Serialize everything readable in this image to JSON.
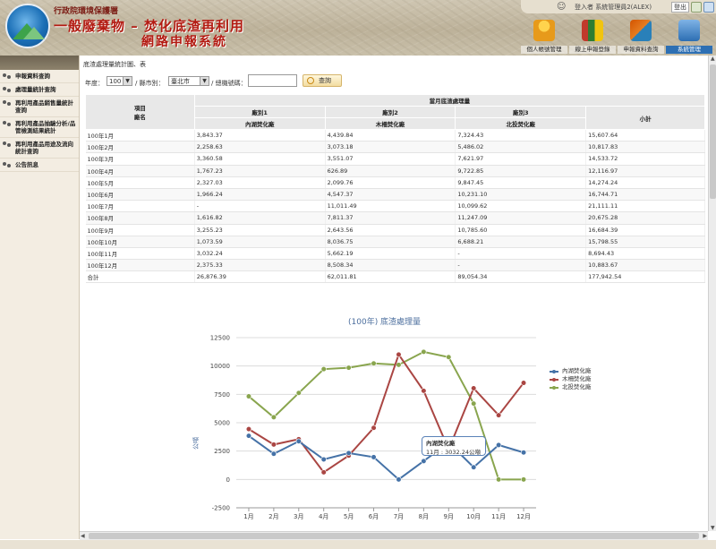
{
  "header": {
    "org": "行政院環境保護署",
    "system_line1": "一般廢棄物 – 焚化底渣再利用",
    "system_line2": "網路申報系統",
    "login_info": "登入者 系統管理員2(ALEX)",
    "logout": "登出",
    "nav": [
      {
        "label": "個人帳號管理",
        "icon": "person-icon"
      },
      {
        "label": "線上申報登錄",
        "icon": "books-icon"
      },
      {
        "label": "申報資料查詢",
        "icon": "tools-icon"
      },
      {
        "label": "系統管理",
        "icon": "computer-icon",
        "active": true
      }
    ]
  },
  "sidebar": {
    "items": [
      {
        "label": "申報資料查詢"
      },
      {
        "label": "處理量統計查詢"
      },
      {
        "label": "再利用產品銷售量統計查詢"
      },
      {
        "label": "再利用產品抽驗分析/品管檢測結果統計"
      },
      {
        "label": "再利用產品用途及流向統計查詢"
      },
      {
        "label": "公告訊息"
      }
    ]
  },
  "main": {
    "breadcrumb": "底渣處理量統計圖、表",
    "filters": {
      "year_label": "年度：",
      "year_value": "100",
      "city_label": "/ 縣市別：",
      "city_value": "臺北市",
      "agency_label": "/ 總機號碼：",
      "query_label": "查詢"
    },
    "table": {
      "header_item": "項目",
      "header_factory": "廠名",
      "header_group": "當月底渣處理量",
      "categories": [
        "廠別1",
        "廠別2",
        "廠別3"
      ],
      "factories": [
        "內湖焚化廠",
        "木柵焚化廠",
        "北投焚化廠"
      ],
      "subtotal": "小計",
      "rows": [
        [
          "100年1月",
          "3,843.37",
          "4,439.84",
          "7,324.43",
          "15,607.64"
        ],
        [
          "100年2月",
          "2,258.63",
          "3,073.18",
          "5,486.02",
          "10,817.83"
        ],
        [
          "100年3月",
          "3,360.58",
          "3,551.07",
          "7,621.97",
          "14,533.72"
        ],
        [
          "100年4月",
          "1,767.23",
          "626.89",
          "9,722.85",
          "12,116.97"
        ],
        [
          "100年5月",
          "2,327.03",
          "2,099.76",
          "9,847.45",
          "14,274.24"
        ],
        [
          "100年6月",
          "1,966.24",
          "4,547.37",
          "10,231.10",
          "16,744.71"
        ],
        [
          "100年7月",
          "-",
          "11,011.49",
          "10,099.62",
          "21,111.11"
        ],
        [
          "100年8月",
          "1,616.82",
          "7,811.37",
          "11,247.09",
          "20,675.28"
        ],
        [
          "100年9月",
          "3,255.23",
          "2,643.56",
          "10,785.60",
          "16,684.39"
        ],
        [
          "100年10月",
          "1,073.59",
          "8,036.75",
          "6,688.21",
          "15,798.55"
        ],
        [
          "100年11月",
          "3,032.24",
          "5,662.19",
          "-",
          "8,694.43"
        ],
        [
          "100年12月",
          "2,375.33",
          "8,508.34",
          "-",
          "10,883.67"
        ],
        [
          "合計",
          "26,876.39",
          "62,011.81",
          "89,054.34",
          "177,942.54"
        ]
      ]
    },
    "tooltip": {
      "title": "內湖焚化廠",
      "text": "11月 : 3032.24公噸"
    }
  },
  "colors": {
    "series1": "#4572a7",
    "series2": "#aa4643",
    "series3": "#89a54e"
  },
  "chart_data": {
    "type": "line",
    "title": "(100年) 底渣處理量",
    "ylabel": "公噸",
    "ylim": [
      -2500,
      12500
    ],
    "yticks": [
      -2500,
      0,
      2500,
      5000,
      7500,
      10000,
      12500
    ],
    "categories": [
      "1月",
      "2月",
      "3月",
      "4月",
      "5月",
      "6月",
      "7月",
      "8月",
      "9月",
      "10月",
      "11月",
      "12月"
    ],
    "series": [
      {
        "name": "內湖焚化廠",
        "values": [
          3843.37,
          2258.63,
          3360.58,
          1767.23,
          2327.03,
          1966.24,
          0,
          1616.82,
          3255.23,
          1073.59,
          3032.24,
          2375.33
        ]
      },
      {
        "name": "木柵焚化廠",
        "values": [
          4439.84,
          3073.18,
          3551.07,
          626.89,
          2099.76,
          4547.37,
          11011.49,
          7811.37,
          2643.56,
          8036.75,
          5662.19,
          8508.34
        ]
      },
      {
        "name": "北投焚化廠",
        "values": [
          7324.43,
          5486.02,
          7621.97,
          9722.85,
          9847.45,
          10231.1,
          10099.62,
          11247.09,
          10785.6,
          6688.21,
          0,
          0
        ]
      }
    ],
    "legend": "right",
    "grid": true
  }
}
